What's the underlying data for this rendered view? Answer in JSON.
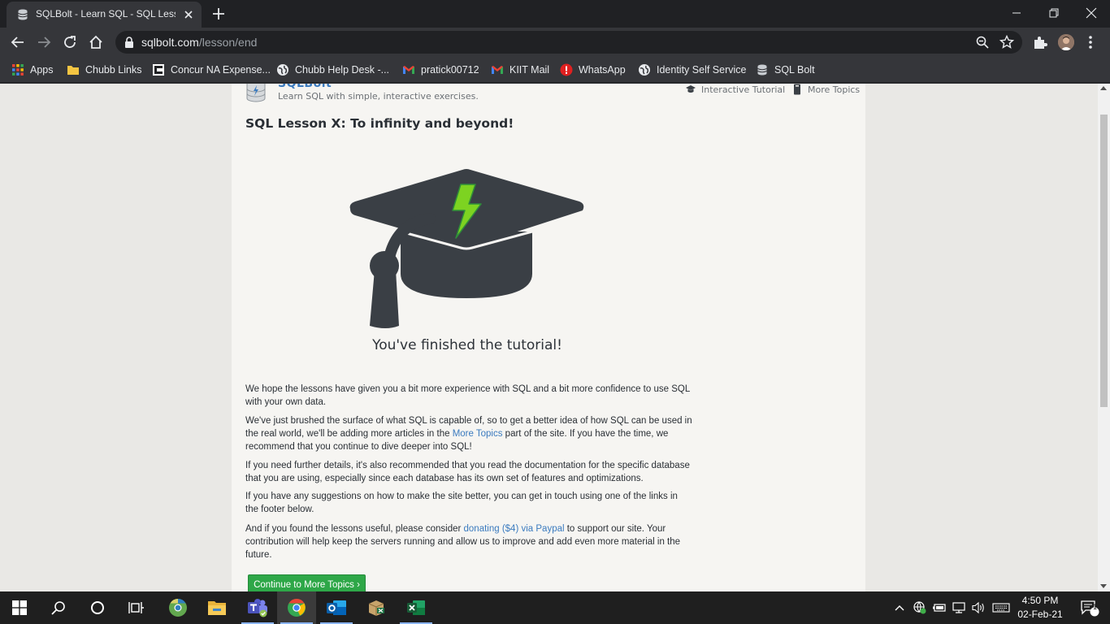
{
  "browser": {
    "tab_title": "SQLBolt - Learn SQL - SQL Lesson X: To infinity and beyond!",
    "url_host": "sqlbolt.com",
    "url_path": "/lesson/end"
  },
  "bookmarks": [
    {
      "label": "Apps",
      "icon": "apps-grid-icon"
    },
    {
      "label": "Chubb Links",
      "icon": "folder-icon"
    },
    {
      "label": "Concur NA Expense...",
      "icon": "concur-icon"
    },
    {
      "label": "Chubb Help Desk -...",
      "icon": "globe-icon"
    },
    {
      "label": "pratick00712",
      "icon": "gmail-icon"
    },
    {
      "label": "KIIT Mail",
      "icon": "gmail-icon"
    },
    {
      "label": "WhatsApp",
      "icon": "whatsapp-icon"
    },
    {
      "label": "Identity Self Service",
      "icon": "globe-icon"
    },
    {
      "label": "SQL Bolt",
      "icon": "database-icon"
    }
  ],
  "site": {
    "name": "SQLBolt",
    "tagline": "Learn SQL with simple, interactive exercises.",
    "nav_tutorial": "Interactive Tutorial",
    "nav_topics": "More Topics"
  },
  "lesson": {
    "title": "SQL Lesson X: To infinity and beyond!",
    "finished": "You've finished the tutorial!",
    "p1": "We hope the lessons have given you a bit more experience with SQL and a bit more confidence to use SQL with your own data.",
    "p2_before": "We've just brushed the surface of what SQL is capable of, so to get a better idea of how SQL can be used in the real world, we'll be adding more articles in the ",
    "p2_link": "More Topics",
    "p2_after": " part of the site. If you have the time, we recommend that you continue to dive deeper into SQL!",
    "p3": "If you need further details, it's also recommended that you read the documentation for the specific database that you are using, especially since each database has its own set of features and optimizations.",
    "p4": "If you have any suggestions on how to make the site better, you can get in touch using one of the links in the footer below.",
    "p5_before": "And if you found the lessons useful, please consider ",
    "p5_link": "donating ($4) via Paypal",
    "p5_after": " to support our site. Your contribution will help keep the servers running and allow us to improve and add even more material in the future.",
    "cta": "Continue to More Topics ›"
  },
  "taskbar": {
    "time": "4:50 PM",
    "date": "02-Feb-21",
    "notification_count": "1",
    "apps": [
      "start-icon",
      "search-icon",
      "cortana-icon",
      "task-view-icon",
      "chrome-canary-icon",
      "file-explorer-icon",
      "teams-icon",
      "chrome-icon",
      "outlook-icon",
      "package-icon",
      "excel-icon"
    ]
  },
  "colors": {
    "accent_link": "#3b7bbf",
    "cta_green": "#2ea748",
    "bolt_green": "#7dd321",
    "hat": "#3a3f45"
  }
}
